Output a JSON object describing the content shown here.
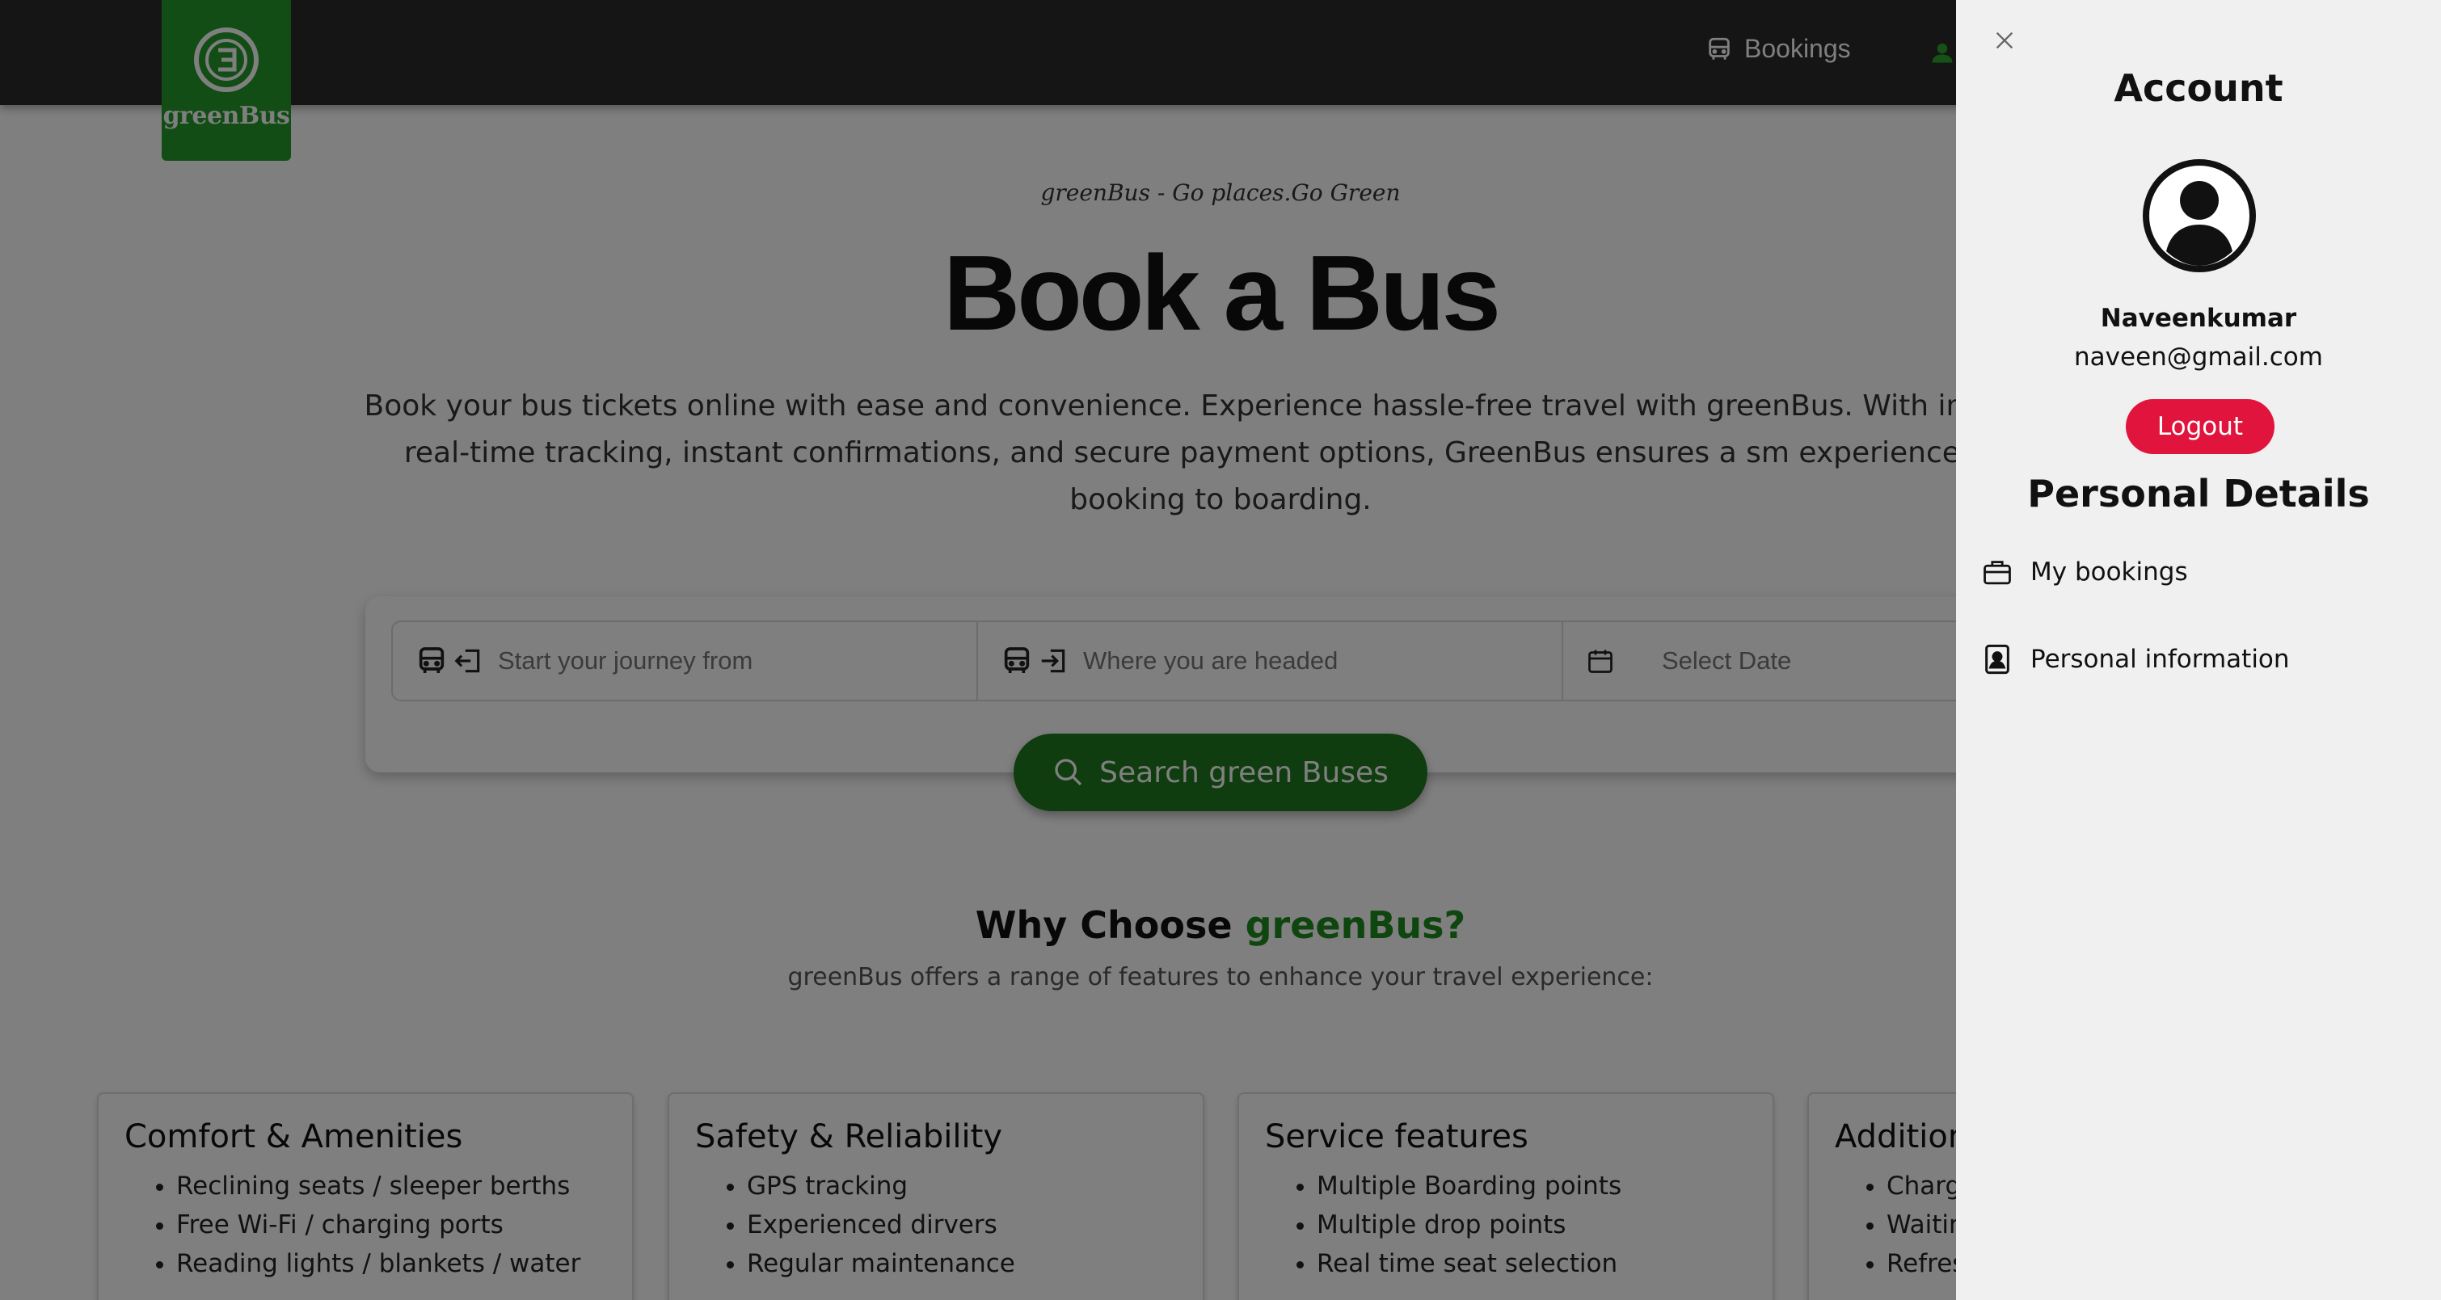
{
  "brand": {
    "name": "greenBus",
    "logo_color": "#229a28"
  },
  "nav": {
    "bookings_label": "Bookings"
  },
  "hero": {
    "tagline": "greenBus - Go places.Go Green",
    "title": "Book a Bus",
    "description": "Book your bus tickets online with ease and convenience. Experience hassle-free travel with greenBus. With interface, real-time tracking, instant confirmations, and secure payment options, GreenBus ensures a sm experience from booking to boarding."
  },
  "search": {
    "from_placeholder": "Start your journey from",
    "to_placeholder": "Where you are headed",
    "date_placeholder": "Select Date",
    "button_label": "Search green Buses",
    "button_color": "#1f7a1f"
  },
  "why": {
    "title_prefix": "Why Choose ",
    "title_accent": "greenBus?",
    "subtitle": "greenBus offers a range of features to enhance your travel experience:"
  },
  "features": [
    {
      "title": "Comfort & Amenities",
      "items": [
        "Reclining seats / sleeper berths",
        "Free Wi-Fi / charging ports",
        "Reading lights / blankets / water"
      ]
    },
    {
      "title": "Safety & Reliability",
      "items": [
        "GPS tracking",
        "Experienced dirvers",
        "Regular maintenance"
      ]
    },
    {
      "title": "Service features",
      "items": [
        "Multiple Boarding points",
        "Multiple drop points",
        "Real time seat selection"
      ]
    },
    {
      "title": "Addition",
      "items": [
        "Charg",
        "Waitin",
        "Refres"
      ]
    }
  ],
  "drawer": {
    "title": "Account",
    "user_name": "Naveenkumar",
    "user_email": "naveen@gmail.com",
    "logout_label": "Logout",
    "logout_color": "#e0143c",
    "section_title": "Personal Details",
    "items": [
      {
        "label": "My bookings",
        "icon": "briefcase-icon"
      },
      {
        "label": "Personal information",
        "icon": "contact-card-icon"
      }
    ]
  }
}
